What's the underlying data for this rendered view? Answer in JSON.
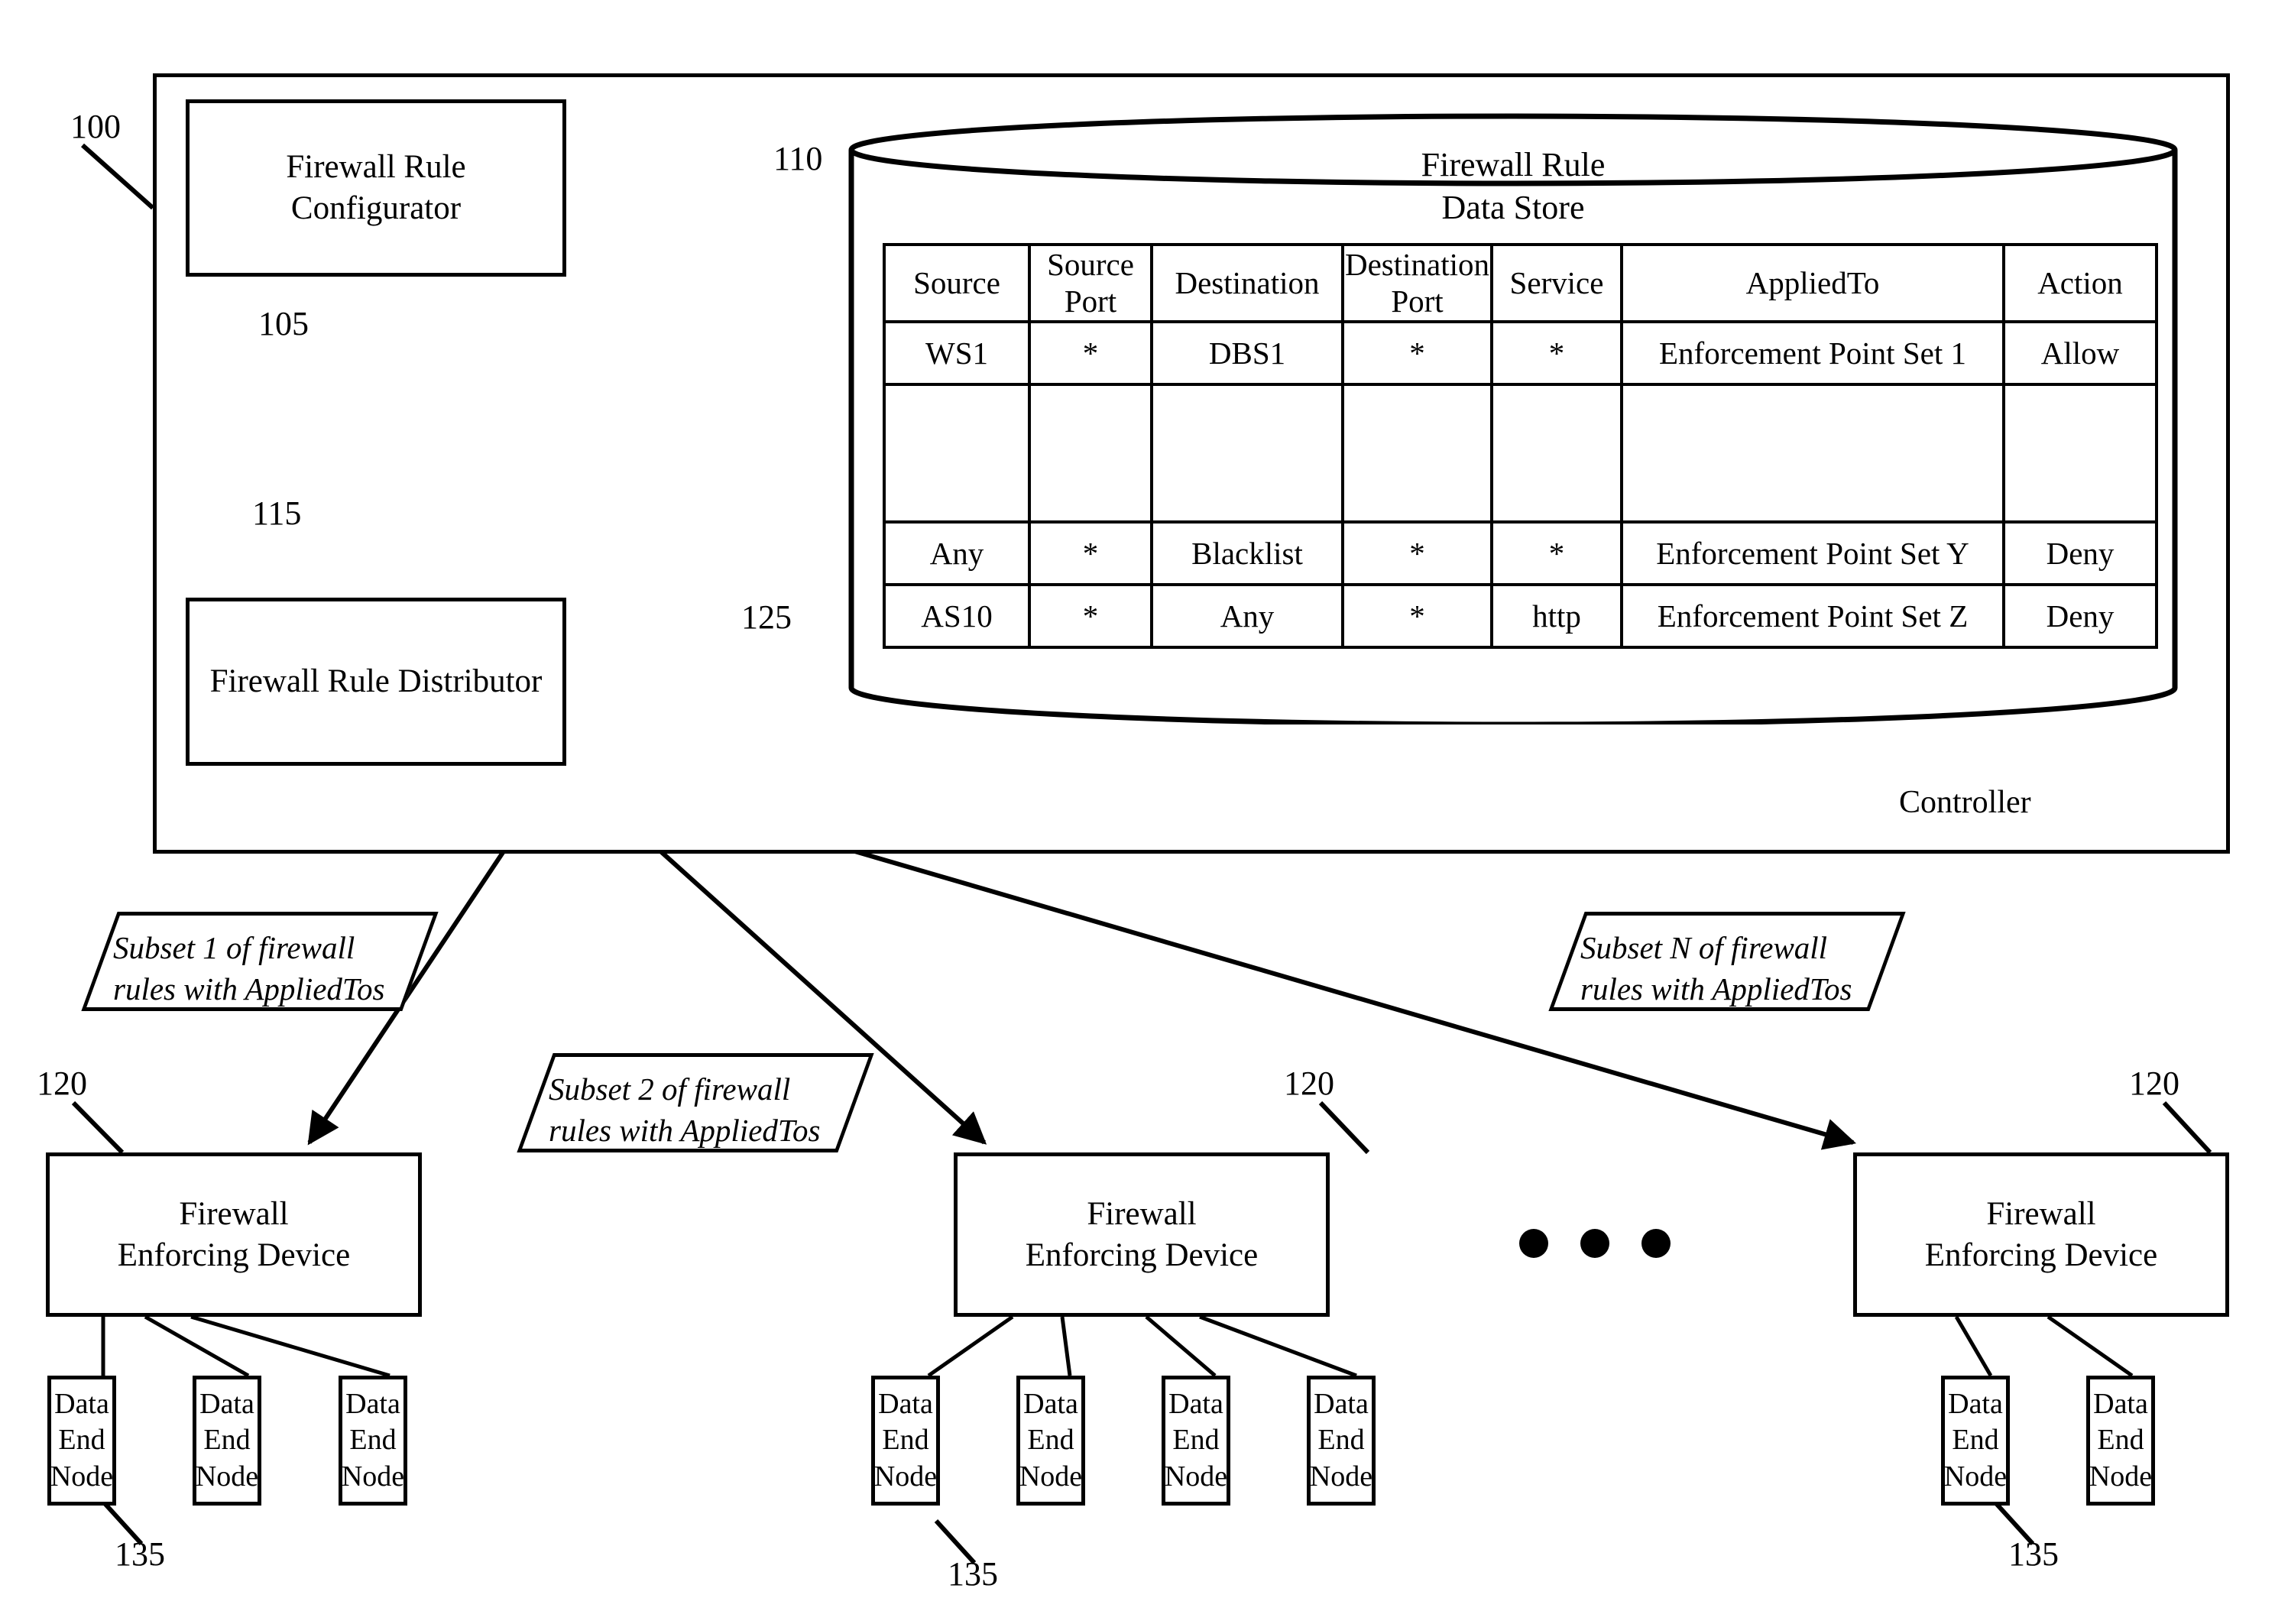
{
  "figure": {
    "controller_label": "Controller",
    "system_ref": "100"
  },
  "controller": {
    "configurator": {
      "label": "Firewall Rule\nConfigurator",
      "ref": "105"
    },
    "distributor": {
      "label": "Firewall Rule Distributor",
      "ref": "115"
    },
    "data_store": {
      "title": "Firewall Rule\nData Store",
      "ref": "110",
      "row_ref": "125"
    }
  },
  "table": {
    "headers": [
      "Source",
      "Source\nPort",
      "Destination",
      "Destination\nPort",
      "Service",
      "AppliedTo",
      "Action"
    ],
    "rows": [
      [
        "WS1",
        "*",
        "DBS1",
        "*",
        "*",
        "Enforcement Point Set 1",
        "Allow"
      ],
      [
        "",
        "",
        "",
        "",
        "",
        "",
        ""
      ],
      [
        "Any",
        "*",
        "Blacklist",
        "*",
        "*",
        "Enforcement Point Set Y",
        "Deny"
      ],
      [
        "AS10",
        "*",
        "Any",
        "*",
        "http",
        "Enforcement Point Set Z",
        "Deny"
      ]
    ]
  },
  "subsets": [
    {
      "text": "Subset 1 of firewall\nrules with AppliedTos"
    },
    {
      "text": "Subset 2 of firewall\nrules with AppliedTos"
    },
    {
      "text": "Subset N of firewall\nrules with AppliedTos"
    }
  ],
  "devices": [
    {
      "label": "Firewall\nEnforcing Device",
      "ref": "120",
      "node_ref": "135",
      "nodes": [
        {
          "label": "Data\nEnd\nNode"
        },
        {
          "label": "Data\nEnd\nNode"
        },
        {
          "label": "Data\nEnd\nNode"
        }
      ]
    },
    {
      "label": "Firewall\nEnforcing Device",
      "ref": "120",
      "node_ref": "135",
      "nodes": [
        {
          "label": "Data\nEnd\nNode"
        },
        {
          "label": "Data\nEnd\nNode"
        },
        {
          "label": "Data\nEnd\nNode"
        },
        {
          "label": "Data\nEnd\nNode"
        }
      ]
    },
    {
      "label": "Firewall\nEnforcing Device",
      "ref": "120",
      "node_ref": "135",
      "nodes": [
        {
          "label": "Data\nEnd\nNode"
        },
        {
          "label": "Data\nEnd\nNode"
        }
      ]
    }
  ],
  "ellipsis": "•••",
  "colors": {
    "stroke": "#000000",
    "background": "#ffffff"
  }
}
